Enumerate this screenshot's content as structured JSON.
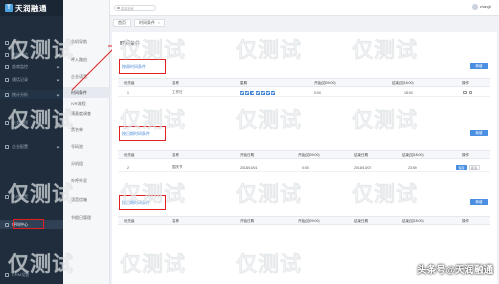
{
  "app": {
    "name": "天润融通",
    "logo_letter": "T"
  },
  "sidebar": {
    "items": [
      {
        "label": "首页"
      },
      {
        "label": "数据概览"
      },
      {
        "label": "坐席监控"
      },
      {
        "label": "通话记录"
      },
      {
        "label": "统计分析"
      },
      {
        "label": "业务管理"
      },
      {
        "label": "企业配置"
      },
      {
        "label": "呼叫中心"
      },
      {
        "label": "CRM设置"
      },
      {
        "label": "系统设置"
      }
    ],
    "selected": "呼叫中心",
    "bottom_label": "CRM设置"
  },
  "submenu": {
    "items": [
      {
        "label": "总机导航"
      },
      {
        "label": "呼入路由"
      },
      {
        "label": "企业语音"
      },
      {
        "label": "时间条件"
      },
      {
        "label": "IVR流程"
      },
      {
        "label": "满意度调查"
      },
      {
        "label": "黑名单"
      },
      {
        "label": "号码池"
      },
      {
        "label": "分机组"
      },
      {
        "label": "外呼外显"
      },
      {
        "label": "语音信箱"
      },
      {
        "label": "节假日管理"
      }
    ],
    "selected": "时间条件"
  },
  "topbar": {
    "search_placeholder": "菜单检索",
    "user_name": "zhangli"
  },
  "tabs": [
    {
      "label": "首页"
    },
    {
      "label": "时间条件"
    }
  ],
  "page": {
    "title": "时间条件",
    "sections": [
      {
        "title": "按周时间条件",
        "add_label": "新增",
        "columns": [
          "优先级",
          "名称",
          "星期",
          "开始(如09:00)",
          "结束(如18:00)",
          "操作"
        ],
        "rows": [
          {
            "priority": "1",
            "name": "工作日",
            "start": "9:00",
            "end": "18:00"
          }
        ]
      },
      {
        "title": "按日期时间条件",
        "add_label": "新增",
        "columns": [
          "优先级",
          "名称",
          "开始日期",
          "开始(如09:00)",
          "结束日期",
          "结束(如18:00)",
          "操作"
        ],
        "rows": [
          {
            "priority": "2",
            "name": "国庆节",
            "start_date": "2018/10/01",
            "start": "0:00",
            "end_date": "2018/10/07",
            "end": "23:59"
          }
        ]
      },
      {
        "title": "按日期时间条件",
        "add_label": "新增",
        "columns": [
          "优先级",
          "名称",
          "开始日期",
          "开始(如09:00)",
          "结束日期",
          "结束(如18:00)",
          "操作"
        ],
        "rows": []
      }
    ],
    "row_action_save": "保存",
    "row_action_cancel": "取消"
  },
  "watermark": {
    "text": "仅测试"
  },
  "credit": "头条号@天润融通",
  "colors": {
    "sidebar": "#1f2d3d",
    "accent": "#4b8fe2",
    "highlight_box": "#e02020"
  }
}
